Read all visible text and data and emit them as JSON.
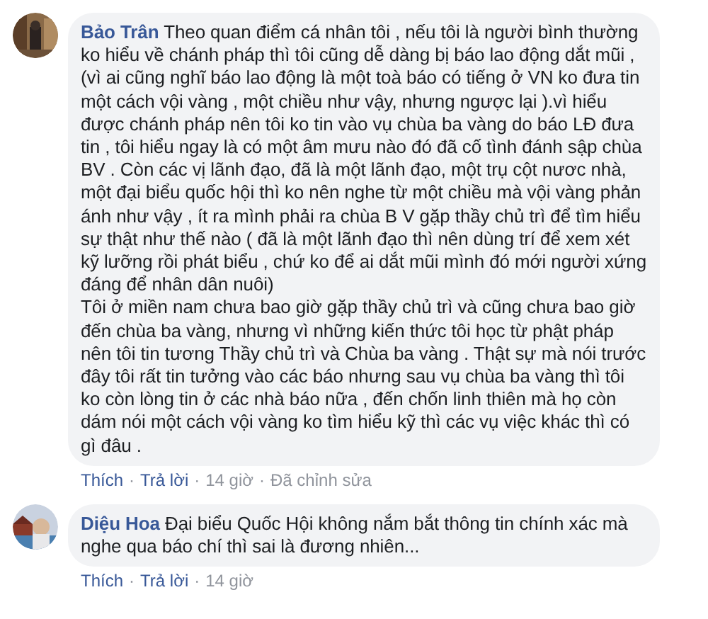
{
  "comments": [
    {
      "author": "Bảo Trân",
      "paragraphs": [
        "Theo quan điểm cá nhân tôi , nếu tôi là người bình thường ko hiểu về chánh pháp thì tôi cũng dễ dàng bị báo lao động dắt mũi , (vì ai cũng nghĩ báo lao động là một toà báo có tiếng ở VN ko đưa tin một cách vội vàng , một chiều như vậy, nhưng ngược lại ).vì hiểu được chánh pháp nên tôi ko tin vào vụ chùa ba vàng do báo LĐ đưa tin , tôi hiểu ngay là có một âm mưu nào đó đã cố tình đánh sập chùa BV . Còn các vị lãnh đạo, đã là một lãnh đạo, một trụ cột nươc nhà, một đại biểu quốc hội thì ko nên nghe từ một chiều mà vội vàng phản ánh như vậy , ít ra mình phải ra chùa B V gặp thầy chủ trì để tìm hiểu sự thật như thế nào ( đã là một lãnh đạo thì nên dùng trí để xem xét kỹ lưỡng rồi phát biểu , chứ ko để ai dắt mũi mình đó mới người xứng đáng để nhân dân nuôi)",
        "Tôi ở miền nam chưa bao giờ gặp thầy chủ trì và cũng chưa bao giờ đến chùa ba vàng, nhưng vì những kiến thức tôi học từ phật pháp nên tôi tin tương Thầy chủ trì và Chùa ba vàng . Thật sự mà nói trước đây tôi rất tin tưởng vào các báo nhưng sau vụ chùa ba vàng thì tôi ko còn lòng tin ở các nhà báo nữa , đến chốn linh thiên mà họ còn dám nói một cách vội vàng ko tìm hiểu kỹ thì các vụ việc khác thì có gì đâu ."
      ],
      "actions": [
        {
          "kind": "link",
          "text": "Thích"
        },
        {
          "kind": "sep",
          "text": "·"
        },
        {
          "kind": "link",
          "text": "Trả lời"
        },
        {
          "kind": "sep",
          "text": "·"
        },
        {
          "kind": "meta",
          "text": "14 giờ"
        },
        {
          "kind": "sep",
          "text": "·"
        },
        {
          "kind": "meta",
          "text": "Đã chỉnh sửa"
        }
      ]
    },
    {
      "author": "Diệu Hoa",
      "paragraphs": [
        "Đại biểu Quốc Hội không nắm bắt thông tin chính xác mà nghe qua báo chí thì sai là đương nhiên..."
      ],
      "actions": [
        {
          "kind": "link",
          "text": "Thích"
        },
        {
          "kind": "sep",
          "text": "·"
        },
        {
          "kind": "link",
          "text": "Trả lời"
        },
        {
          "kind": "sep",
          "text": "·"
        },
        {
          "kind": "meta",
          "text": "14 giờ"
        }
      ]
    }
  ]
}
